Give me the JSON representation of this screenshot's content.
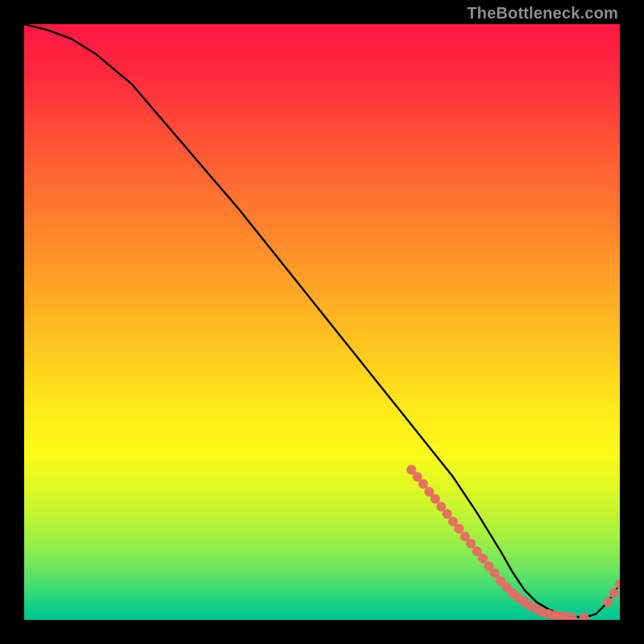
{
  "watermark": "TheBottleneck.com",
  "chart_data": {
    "type": "line",
    "title": "",
    "xlabel": "",
    "ylabel": "",
    "xlim": [
      0,
      100
    ],
    "ylim": [
      0,
      100
    ],
    "grid": false,
    "legend": false,
    "background": "red-yellow-green-vertical-gradient",
    "series": [
      {
        "name": "bottleneck-curve",
        "style": "solid-black",
        "x": [
          0,
          4,
          8,
          12,
          18,
          24,
          30,
          36,
          42,
          48,
          54,
          60,
          66,
          72,
          76,
          80,
          82,
          84,
          86,
          88,
          90,
          92,
          94,
          96,
          98,
          100
        ],
        "y": [
          100,
          99,
          97.5,
          95,
          90,
          83,
          76,
          69,
          61.5,
          54,
          46.5,
          39,
          31.5,
          24,
          18,
          11.5,
          8,
          5,
          3,
          1.8,
          1,
          0.6,
          0.4,
          1,
          3,
          6
        ]
      },
      {
        "name": "observation-dots",
        "style": "salmon-dots",
        "x": [
          65,
          66,
          67,
          68,
          69,
          70,
          71,
          72,
          73,
          74,
          75,
          76,
          77,
          78,
          79,
          80,
          81,
          82,
          83,
          84,
          85,
          86,
          87,
          88,
          89,
          90,
          91,
          92,
          94,
          98,
          99,
          100
        ],
        "y": [
          25.2,
          24,
          22.8,
          21.5,
          20.3,
          19,
          17.8,
          16.5,
          15.3,
          14,
          12.8,
          11.5,
          10.3,
          9,
          7.8,
          6.5,
          5.5,
          4.5,
          3.7,
          3,
          2.3,
          1.8,
          1.3,
          1,
          0.8,
          0.6,
          0.5,
          0.4,
          0.4,
          3,
          4.5,
          6
        ]
      }
    ]
  }
}
